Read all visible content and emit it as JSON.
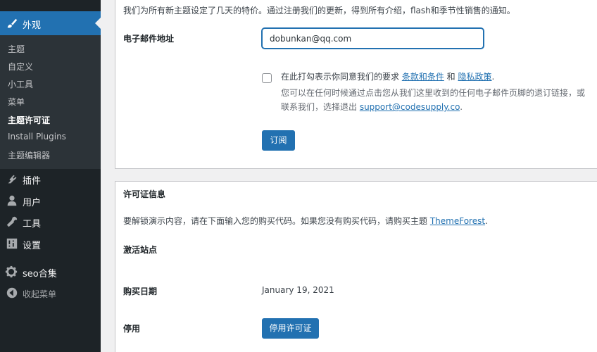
{
  "sidebar": {
    "active_menu": "外观",
    "submenu": [
      "主题",
      "自定义",
      "小工具",
      "菜单",
      "主题许可证",
      "Install Plugins",
      "主题编辑器"
    ],
    "menu": [
      {
        "label": "插件",
        "icon": "plugin-icon"
      },
      {
        "label": "用户",
        "icon": "user-icon"
      },
      {
        "label": "工具",
        "icon": "wrench-icon"
      },
      {
        "label": "设置",
        "icon": "settings-icon"
      },
      {
        "label": "seo合集",
        "icon": "gear-icon"
      }
    ],
    "collapse": "收起菜单"
  },
  "subscribe": {
    "intro": "我们为所有新主题设定了几天的特价。通过注册我们的更新，得到所有介绍，flash和季节性销售的通知。",
    "email_label": "电子邮件地址",
    "email_value": "dobunkan@qq.com",
    "consent_prefix": "在此打勾表示你同意我们的要求 ",
    "terms_link": "条款和条件",
    "and": " 和 ",
    "privacy_link": "隐私政策",
    "period": ".",
    "note_line1": "您可以在任何时候通过点击您从我们这里收到的任何电子邮件页脚的退订链接，或",
    "note_line2_prefix": "联系我们，选择退出 ",
    "support_email": "support@codesupply.co",
    "note_line2_suffix": ".",
    "button": "订阅"
  },
  "license": {
    "title": "许可证信息",
    "desc_prefix": "要解锁演示内容，请在下面输入您的购买代码。如果您没有购买代码，请购买主题 ",
    "themeforest": "ThemeForest",
    "desc_suffix": ".",
    "active_site_label": "激活站点",
    "purchase_date_label": "购买日期",
    "purchase_date": "January 19, 2021",
    "deactivate_label": "停用",
    "deactivate_button": "停用许可证"
  }
}
